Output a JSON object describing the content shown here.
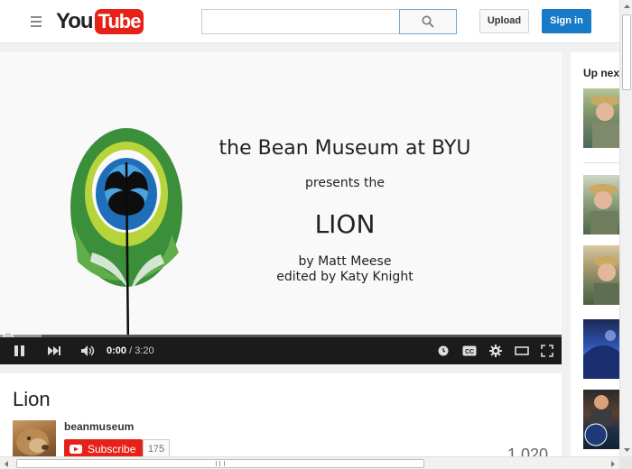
{
  "header": {
    "logo_you": "You",
    "logo_tube": "Tube",
    "search_placeholder": "",
    "upload_label": "Upload",
    "signin_label": "Sign in"
  },
  "video": {
    "slide": {
      "title": "the Bean Museum at BYU",
      "presents": "presents the",
      "name": "LION",
      "by": "by Matt Meese",
      "edited": "edited by Katy Knight"
    },
    "current_time": "0:00",
    "duration": "/ 3:20",
    "progress_fraction": 0
  },
  "info": {
    "title": "Lion",
    "channel": "beanmuseum",
    "subscribe_label": "Subscribe",
    "subscriber_count": "175",
    "view_count": "1,020"
  },
  "sidebar": {
    "up_next_label": "Up next"
  },
  "colors": {
    "brand_red": "#e62117",
    "signin_blue": "#167ac6",
    "player_bar": "#1b1b1b"
  }
}
